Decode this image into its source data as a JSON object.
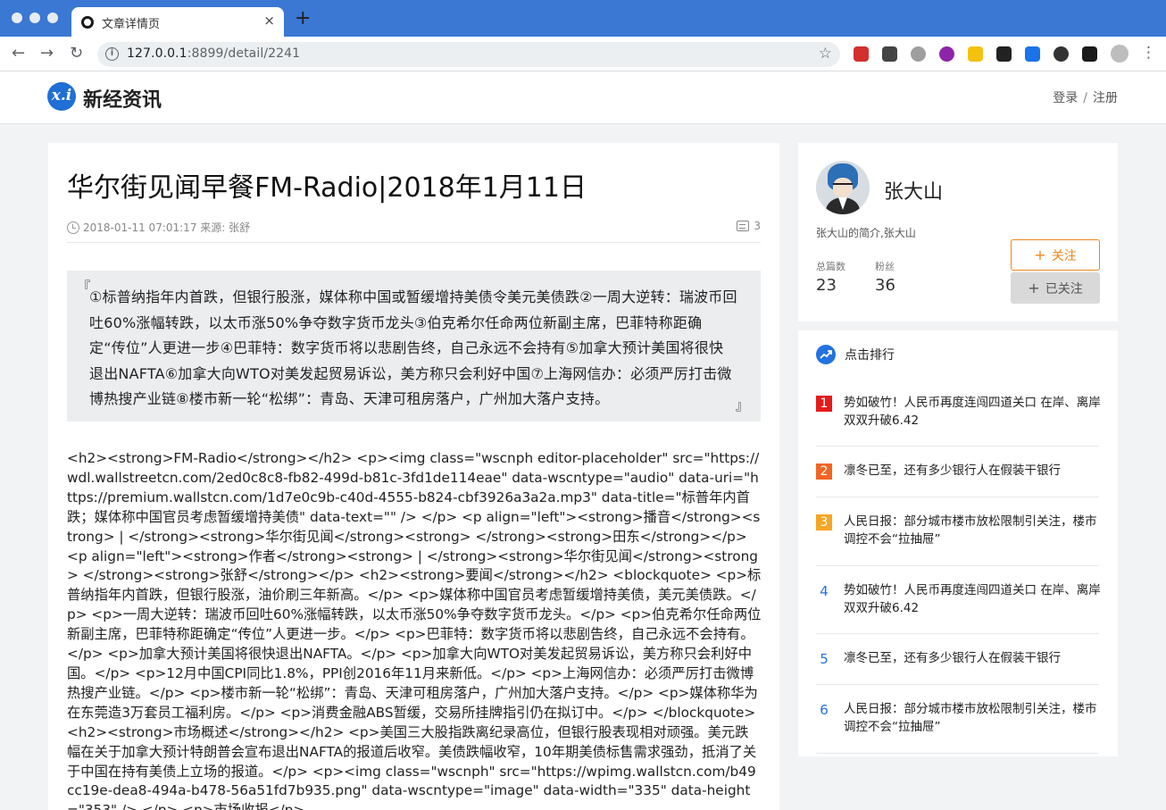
{
  "browser": {
    "tab_title": "文章详情页",
    "tab_close": "×",
    "new_tab": "+",
    "url_host": "127.0.0.1",
    "url_rest": ":8899/detail/2241",
    "nav_back": "←",
    "nav_forward": "→",
    "nav_reload": "↻",
    "info": "i",
    "star": "☆",
    "menu": "⋮",
    "extensions": [
      {
        "icon": "adblock-icon",
        "color": "#d32f2f"
      },
      {
        "icon": "qr-icon",
        "color": "#444444"
      },
      {
        "icon": "globe-icon",
        "color": "#9e9e9e"
      },
      {
        "icon": "purple-circle-icon",
        "color": "#8e24aa"
      },
      {
        "icon": "bolt-icon",
        "color": "#f4c20d"
      },
      {
        "icon": "x-icon",
        "color": "#222222"
      },
      {
        "icon": "translate-icon",
        "color": "#1a73e8"
      },
      {
        "icon": "c-icon",
        "color": "#333333"
      },
      {
        "icon": "puzzle-icon",
        "color": "#1a1a1a"
      },
      {
        "icon": "profile-icon",
        "color": "#bdbdbd"
      }
    ]
  },
  "site": {
    "logo_mark": "x.i",
    "name": "新经资讯",
    "login": "登录",
    "sep": "/",
    "register": "注册"
  },
  "article": {
    "title": "华尔街见闻早餐FM-Radio|2018年1月11日",
    "meta": "2018-01-11 07:01:17 来源: 张舒",
    "comments": "3",
    "quote_open": "『",
    "quote_close": "』",
    "summary": "①标普纳指年内首跌，但银行股涨，媒体称中国或暂缓增持美债令美元美债跌②一周大逆转：瑞波币回吐60%涨幅转跌，以太币涨50%争夺数字货币龙头③伯克希尔任命两位新副主席，巴菲特称距确定“传位”人更进一步④巴菲特：数字货币将以悲剧告终，自己永远不会持有⑤加拿大预计美国将很快退出NAFTA⑥加拿大向WTO对美发起贸易诉讼，美方称只会利好中国⑦上海网信办：必须严厉打击微博热搜产业链⑧楼市新一轮“松绑”：青岛、天津可租房落户，广州加大落户支持。",
    "raw_body": "<h2><strong>FM-Radio</strong></h2> <p><img class=\"wscnph editor-placeholder\" src=\"https://wdl.wallstreetcn.com/2ed0c8c8-fb82-499d-b81c-3fd1de114eae\" data-wscntype=\"audio\" data-uri=\"https://premium.wallstcn.com/1d7e0c9b-c40d-4555-b824-cbf3926a3a2a.mp3\" data-title=\"标普年内首跌；媒体称中国官员考虑暂缓增持美债\" data-text=\"\" /> </p> <p align=\"left\"><strong>播音</strong><strong> | </strong><strong>华尔街见闻</strong><strong> </strong><strong>田东</strong></p> <p align=\"left\"><strong>作者</strong><strong> | </strong><strong>华尔街见闻</strong><strong> </strong><strong>张舒</strong></p> <h2><strong>要闻</strong></h2> <blockquote> <p>标普纳指年内首跌，但银行股涨，油价刷三年新高。</p> <p>媒体称中国官员考虑暂缓增持美债，美元美债跌。</p> <p>一周大逆转：瑞波币回吐60%涨幅转跌，以太币涨50%争夺数字货币龙头。</p> <p>伯克希尔任命两位新副主席，巴菲特称距确定“传位”人更进一步。</p> <p>巴菲特：数字货币将以悲剧告终，自己永远不会持有。</p> <p>加拿大预计美国将很快退出NAFTA。</p> <p>加拿大向WTO对美发起贸易诉讼，美方称只会利好中国。</p> <p>12月中国CPI同比1.8%，PPI创2016年11月来新低。</p> <p>上海网信办：必须严厉打击微博热搜产业链。</p> <p>楼市新一轮“松绑”：青岛、天津可租房落户，广州加大落户支持。</p> <p>媒体称华为在东莞造3万套员工福利房。</p> <p>消费金融ABS暂缓，交易所挂牌指引仍在拟订中。</p> </blockquote> <h2><strong>市场概述</strong></h2> <p>美国三大股指跌离纪录高位，但银行股表现相对顽强。美元跌幅在关于加拿大预计特朗普会宣布退出NAFTA的报道后收窄。美债跌幅收窄，10年期美债标售需求强劲，抵消了关于中国在持有美债上立场的报道。</p> <p><img class=\"wscnph\" src=\"https://wpimg.wallstcn.com/b49cc19e-dea8-494a-b478-56a51fd7b935.png\" data-wscntype=\"image\" data-width=\"335\" data-height=\"353\" /> </p> <p>市场收报</p>"
  },
  "author": {
    "name": "张大山",
    "bio": "张大山的简介,张大山",
    "articles_label": "总篇数",
    "articles_value": "23",
    "fans_label": "粉丝",
    "fans_value": "36",
    "follow_label": "关注",
    "followed_label": "已关注",
    "plus": "+"
  },
  "ranking": {
    "title": "点击排行",
    "items": [
      {
        "num": "1",
        "text": "势如破竹！人民币再度连闯四道关口 在岸、离岸双双升破6.42",
        "badge_color": "#e41b1b"
      },
      {
        "num": "2",
        "text": "凛冬已至，还有多少银行人在假装干银行",
        "badge_color": "#f26522"
      },
      {
        "num": "3",
        "text": "人民日报：部分城市楼市放松限制引关注，楼市调控不会“拉抽屉”",
        "badge_color": "#f6a623"
      },
      {
        "num": "4",
        "text": "势如破竹！人民币再度连闯四道关口 在岸、离岸双双升破6.42"
      },
      {
        "num": "5",
        "text": "凛冬已至，还有多少银行人在假装干银行"
      },
      {
        "num": "6",
        "text": "人民日报：部分城市楼市放松限制引关注，楼市调控不会“拉抽屉”"
      }
    ]
  }
}
